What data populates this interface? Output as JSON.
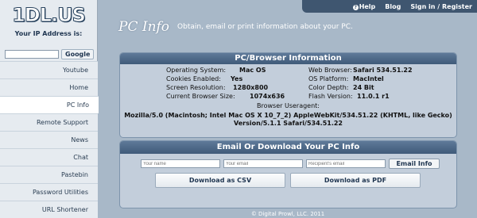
{
  "topnav": {
    "help": "Help",
    "blog": "Blog",
    "signin": "Sign in / Register"
  },
  "sidebar": {
    "logo": "1DL.US",
    "ip_label": "Your IP Address is:",
    "ip_value": "",
    "search_button": "Google",
    "items": [
      {
        "label": "Youtube"
      },
      {
        "label": "Home"
      },
      {
        "label": "PC Info",
        "active": true
      },
      {
        "label": "Remote Support"
      },
      {
        "label": "News"
      },
      {
        "label": "Chat"
      },
      {
        "label": "Pastebin"
      },
      {
        "label": "Password Utilities"
      },
      {
        "label": "URL Shortener"
      }
    ]
  },
  "header": {
    "title": "PC Info",
    "subtitle": "Obtain, email or print information about your PC."
  },
  "browser_panel": {
    "heading": "PC/Browser Information",
    "left": [
      {
        "label": "Operating System:",
        "value": "Mac OS"
      },
      {
        "label": "Cookies Enabled:",
        "value": "Yes"
      },
      {
        "label": "Screen Resolution:",
        "value": "1280x800"
      },
      {
        "label": "Current Browser Size:",
        "value": "1074x636"
      }
    ],
    "right": [
      {
        "label": "Web Browser:",
        "value": "Safari 534.51.22"
      },
      {
        "label": "OS Platform:",
        "value": "MacIntel"
      },
      {
        "label": "Color Depth:",
        "value": "24 Bit"
      },
      {
        "label": "Flash Version:",
        "value": "11.0.1 r1"
      }
    ],
    "useragent_label": "Browser Useragent:",
    "useragent_line1": "Mozilla/5.0 (Macintosh; Intel Mac OS X 10_7_2) AppleWebKit/534.51.22 (KHTML, like Gecko)",
    "useragent_line2": "Version/5.1.1 Safari/534.51.22"
  },
  "email_panel": {
    "heading": "Email Or Download Your PC Info",
    "name_placeholder": "Your name",
    "email_placeholder": "Your email",
    "recipient_placeholder": "Recipient's email",
    "email_button": "Email Info",
    "csv_button": "Download as CSV",
    "pdf_button": "Download as PDF"
  },
  "footer": "© Digital Prowl, LLC. 2011"
}
